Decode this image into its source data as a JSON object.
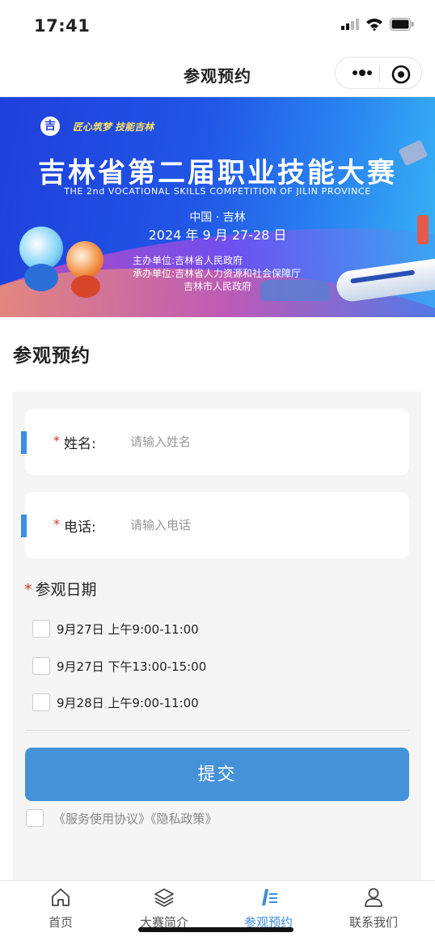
{
  "status_bar": {
    "time": "17:41"
  },
  "navbar": {
    "title": "参观预约"
  },
  "banner": {
    "slogan": "匠心筑梦 技能吉林",
    "logo_char": "吉",
    "title": "吉林省第二届职业技能大赛",
    "subtitle": "THE 2nd VOCATIONAL SKILLS COMPETITION OF JILIN PROVINCE",
    "place": "中国 · 吉林",
    "date": "2024 年 9 月 27-28 日",
    "organizer": "主办单位:吉林省人民政府",
    "co_organizer_1": "承办单位:吉林省人力资源和社会保障厅",
    "co_organizer_2": "吉林市人民政府"
  },
  "page": {
    "section_title": "参观预约"
  },
  "form": {
    "name": {
      "label": "姓名:",
      "placeholder": "请输入姓名",
      "value": ""
    },
    "phone": {
      "label": "电话:",
      "placeholder": "请输入电话",
      "value": ""
    },
    "required_mark": "*",
    "date_title": "参观日期",
    "date_options": [
      {
        "label": "9月27日 上午9:00-11:00",
        "checked": false
      },
      {
        "label": "9月27日 下午13:00-15:00",
        "checked": false
      },
      {
        "label": "9月28日 上午9:00-11:00",
        "checked": false
      }
    ],
    "submit_label": "提交",
    "agreement_text": "《服务使用协议》《隐私政策》"
  },
  "tabbar": {
    "items": [
      {
        "label": "首页",
        "icon": "home-icon",
        "active": false
      },
      {
        "label": "大赛简介",
        "icon": "layers-icon",
        "active": false
      },
      {
        "label": "参观预约",
        "icon": "edit-list-icon",
        "active": true
      },
      {
        "label": "联系我们",
        "icon": "person-icon",
        "active": false
      }
    ]
  },
  "colors": {
    "accent": "#3d8ee0",
    "submit": "#4592d8",
    "required": "#d9342b"
  }
}
